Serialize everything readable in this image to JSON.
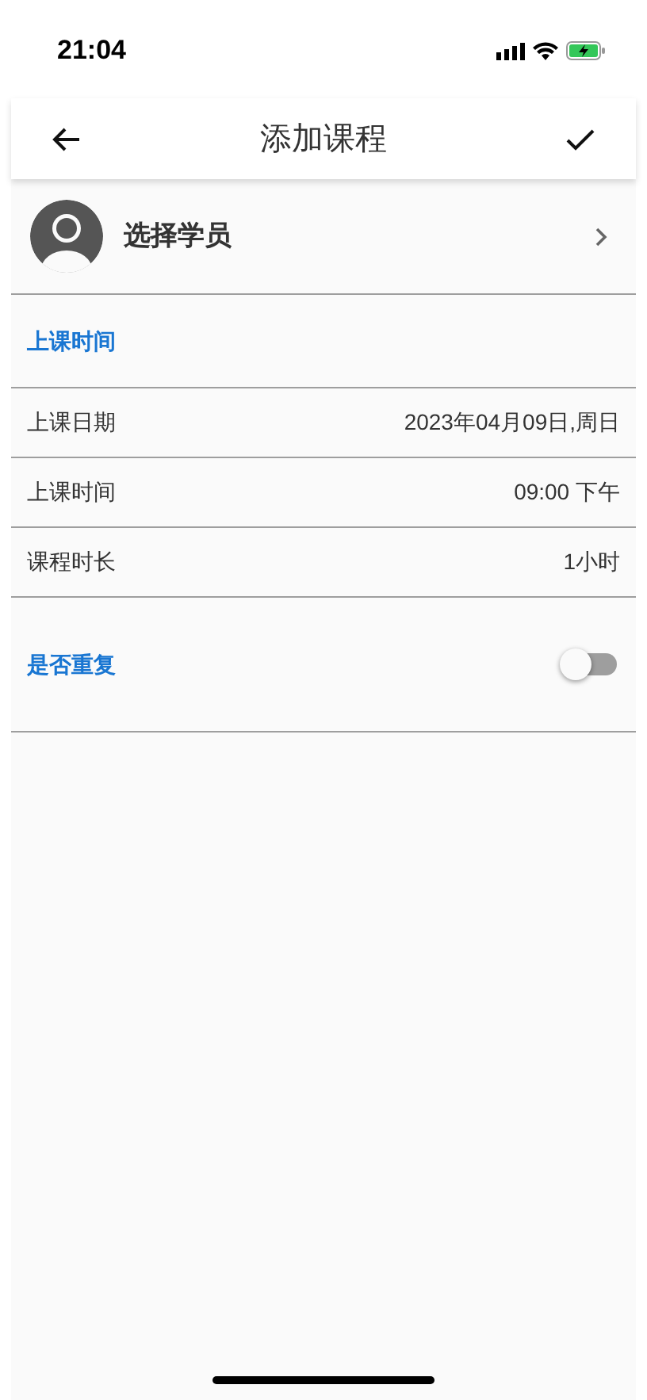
{
  "status_bar": {
    "time": "21:04"
  },
  "app_bar": {
    "title": "添加课程"
  },
  "student": {
    "label": "选择学员"
  },
  "section": {
    "title": "上课时间"
  },
  "rows": [
    {
      "label": "上课日期",
      "value": "2023年04月09日,周日"
    },
    {
      "label": "上课时间",
      "value": "09:00 下午"
    },
    {
      "label": "课程时长",
      "value": "1小时"
    }
  ],
  "repeat": {
    "label": "是否重复",
    "on": false
  }
}
